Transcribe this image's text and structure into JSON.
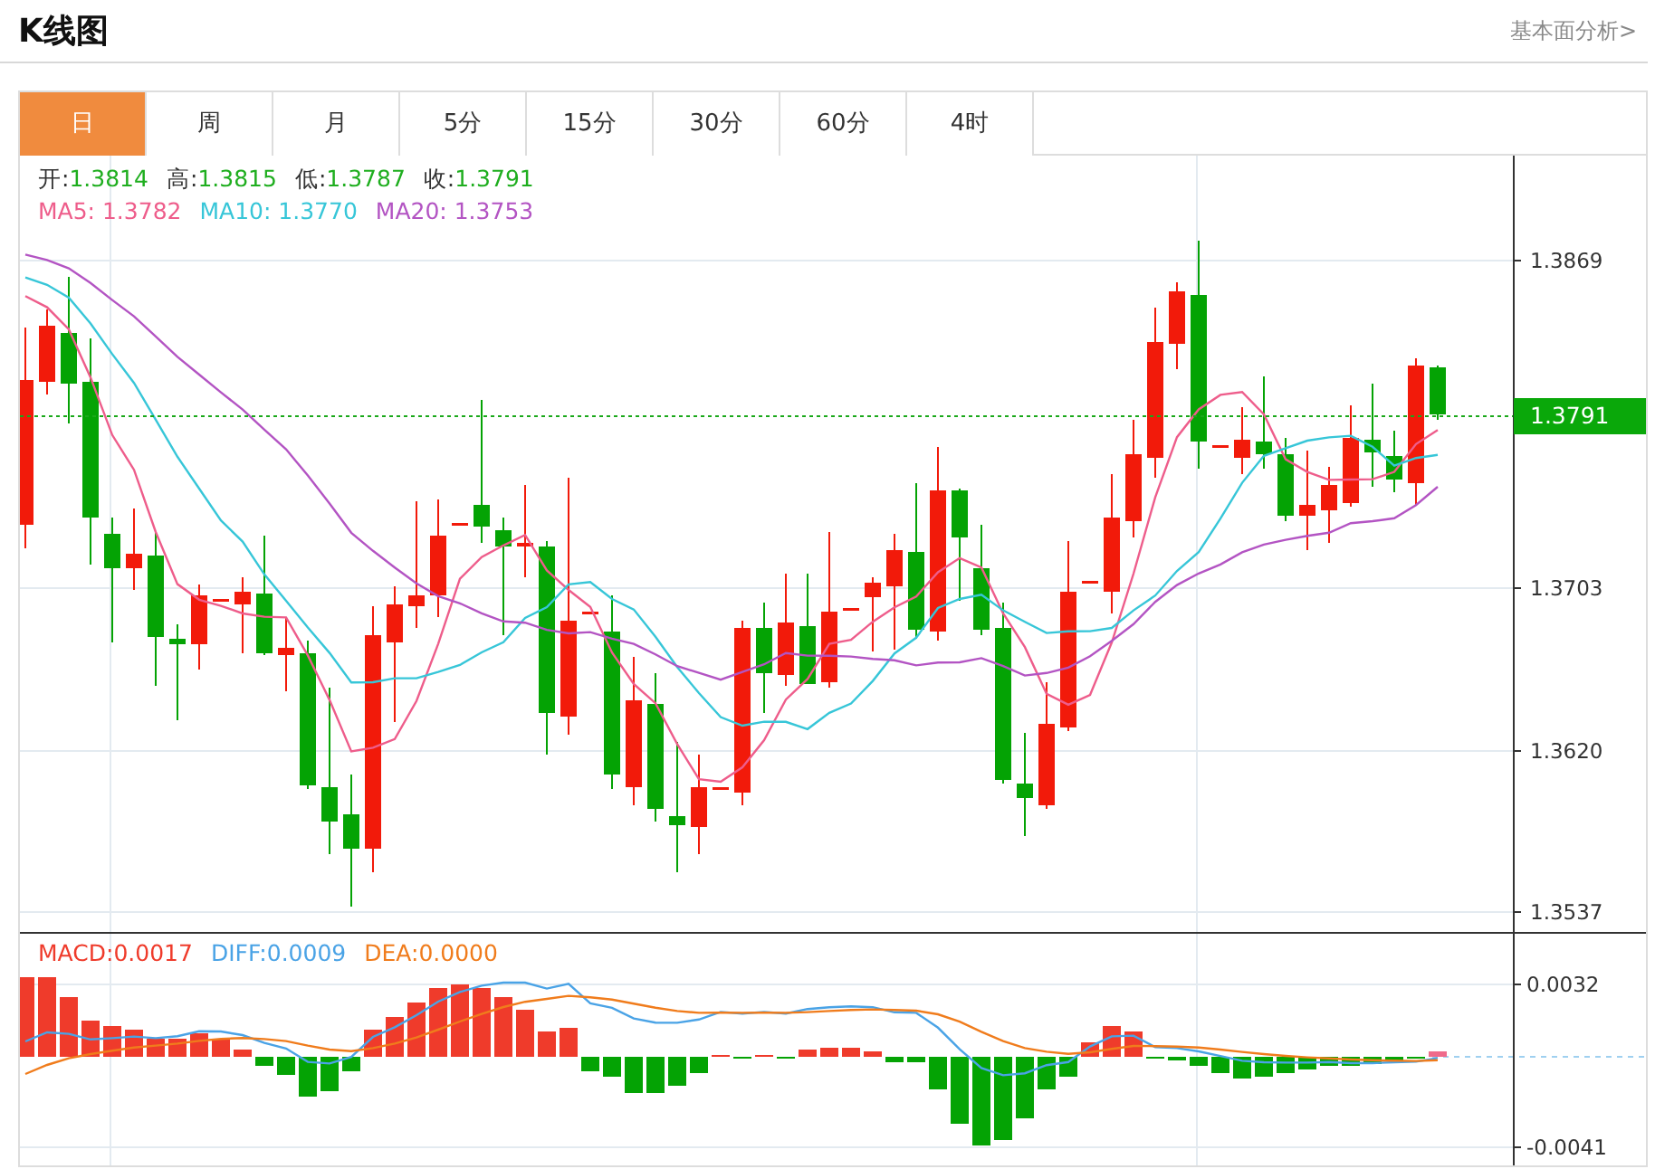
{
  "title": "K线图",
  "link": "基本面分析>",
  "tabs": [
    {
      "label": "日",
      "selected": true
    },
    {
      "label": "周",
      "selected": false
    },
    {
      "label": "月",
      "selected": false
    },
    {
      "label": "5分",
      "selected": false
    },
    {
      "label": "15分",
      "selected": false
    },
    {
      "label": "30分",
      "selected": false
    },
    {
      "label": "60分",
      "selected": false
    },
    {
      "label": "4时",
      "selected": false
    }
  ],
  "quote": [
    {
      "label": "开:",
      "value": "1.3814"
    },
    {
      "label": "高:",
      "value": "1.3815"
    },
    {
      "label": "低:",
      "value": "1.3787"
    },
    {
      "label": "收:",
      "value": "1.3791"
    }
  ],
  "ma": [
    {
      "label": "MA5:",
      "value": "1.3782",
      "color": "#ee5d8b"
    },
    {
      "label": "MA10:",
      "value": "1.3770",
      "color": "#37c6d8"
    },
    {
      "label": "MA20:",
      "value": "1.3753",
      "color": "#b354c3"
    }
  ],
  "price_axis": {
    "ticks": [
      "1.3869",
      "1.3703",
      "1.3620",
      "1.3537"
    ],
    "current": "1.3791"
  },
  "macd": {
    "legend": [
      {
        "label": "MACD:",
        "value": "0.0017",
        "color": "#ef3b2b"
      },
      {
        "label": "DIFF:",
        "value": "0.0009",
        "color": "#4aa3e6"
      },
      {
        "label": "DEA:",
        "value": "0.0000",
        "color": "#f07c1c"
      }
    ],
    "ticks": [
      "0.0032",
      "-0.0041"
    ]
  }
}
